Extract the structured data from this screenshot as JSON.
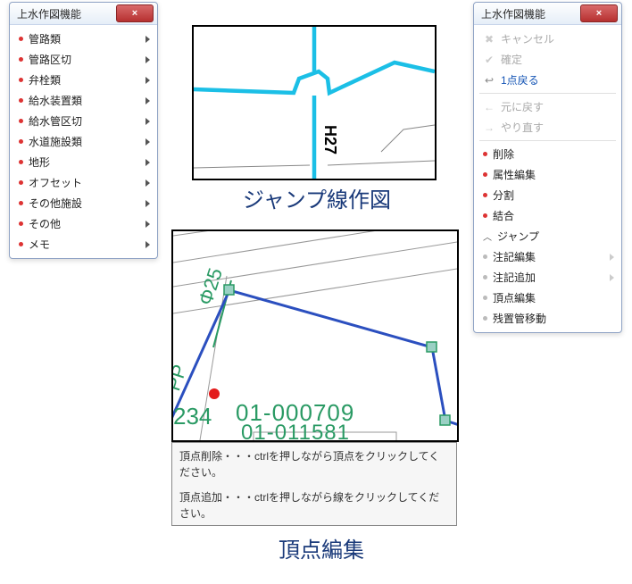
{
  "panel_left": {
    "title": "上水作図機能",
    "close": "×",
    "items": [
      {
        "label": "管路類",
        "arrow": true
      },
      {
        "label": "管路区切",
        "arrow": true
      },
      {
        "label": "弁栓類",
        "arrow": true
      },
      {
        "label": "給水装置類",
        "arrow": true
      },
      {
        "label": "給水管区切",
        "arrow": true
      },
      {
        "label": "水道施設類",
        "arrow": true
      },
      {
        "label": "地形",
        "arrow": true
      },
      {
        "label": "オフセット",
        "arrow": true
      },
      {
        "label": "その他施設",
        "arrow": true
      },
      {
        "label": "その他",
        "arrow": true
      },
      {
        "label": "メモ",
        "arrow": true
      }
    ]
  },
  "panel_right": {
    "title": "上水作図機能",
    "close": "×",
    "top_actions": [
      {
        "icon": "✖",
        "label": "キャンセル",
        "enabled": false
      },
      {
        "icon": "✔",
        "label": "確定",
        "enabled": false
      },
      {
        "icon": "↩",
        "label": "1点戻る",
        "enabled": true
      }
    ],
    "history": [
      {
        "icon": "←",
        "label": "元に戻す",
        "enabled": false
      },
      {
        "icon": "→",
        "label": "やり直す",
        "enabled": false
      }
    ],
    "edit_items": [
      {
        "label": "削除"
      },
      {
        "label": "属性編集"
      },
      {
        "label": "分割"
      },
      {
        "label": "結合"
      }
    ],
    "jump_label": "ジャンプ",
    "tail_items": [
      {
        "label": "注記編集",
        "arrow": true
      },
      {
        "label": "注記追加",
        "arrow": true
      },
      {
        "label": "頂点編集",
        "arrow": false
      },
      {
        "label": "残置管移動",
        "arrow": false
      }
    ]
  },
  "figure1": {
    "caption": "ジャンプ線作図",
    "label_v": "H27"
  },
  "figure2": {
    "caption": "頂点編集",
    "phi": "Φ25",
    "pp": "PP",
    "num_left": "234",
    "code1": "01-000709",
    "code2": "01-011581"
  },
  "instructions": {
    "line1": "頂点削除・・・ctrlを押しながら頂点をクリックしてください。",
    "line2": "頂点追加・・・ctrlを押しながら線をクリックしてください。"
  }
}
